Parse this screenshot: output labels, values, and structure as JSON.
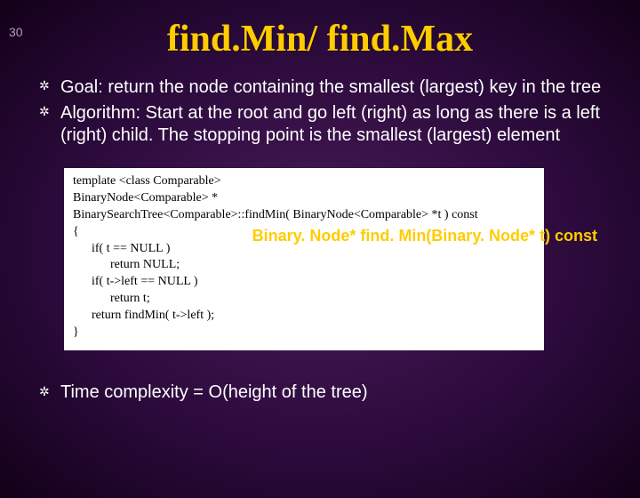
{
  "slide_number": "30",
  "title": "find.Min/ find.Max",
  "bullets": [
    "Goal: return the node containing the smallest (largest) key in the tree",
    "Algorithm: Start at the root and go left (right) as long as there is a left (right) child. The stopping point is the smallest (largest) element"
  ],
  "code": {
    "lines": [
      "template <class Comparable>",
      "BinaryNode<Comparable> *",
      "BinarySearchTree<Comparable>::findMin( BinaryNode<Comparable> *t ) const",
      "{",
      "      if( t == NULL )",
      "            return NULL;",
      "      if( t->left == NULL )",
      "            return t;",
      "      return findMin( t->left );",
      "}"
    ]
  },
  "annotation": "Binary. Node* find. Min(Binary. Node* t) const",
  "bottom_bullet": "Time complexity = O(height of the tree)"
}
